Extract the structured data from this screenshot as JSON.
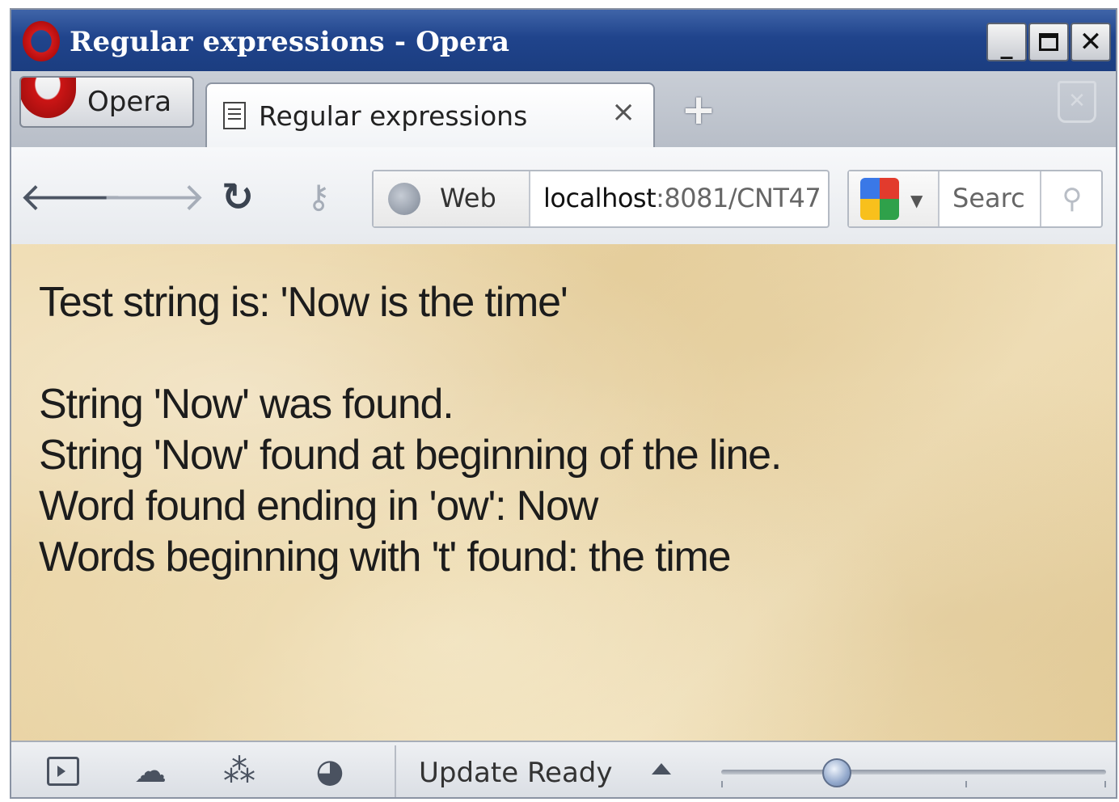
{
  "window": {
    "title": "Regular expressions - Opera"
  },
  "tabbar": {
    "opera_menu_label": "Opera",
    "tabs": [
      {
        "label": "Regular expressions",
        "active": true
      }
    ],
    "close_glyph": "×",
    "new_tab_glyph": "+",
    "trash_glyph": "✕"
  },
  "toolbar": {
    "address": {
      "scheme_label": "Web",
      "url_host": "localhost",
      "url_rest": ":8081/CNT47"
    },
    "search": {
      "placeholder": "Searc"
    }
  },
  "content": {
    "lines": [
      "Test string is: 'Now is the time'",
      "String 'Now' was found.",
      "String 'Now' found at beginning of the line.",
      "Word found ending in 'ow': Now",
      "Words beginning with 't' found: the time"
    ]
  },
  "statusbar": {
    "update_label": "Update Ready",
    "zoom_level": 0.3
  },
  "colors": {
    "titlebar": "#20448c",
    "page_background": "#efdcb2",
    "text": "#1c1c1c"
  },
  "icons": {
    "back": "arrow-left-icon",
    "forward": "arrow-right-icon",
    "reload": "reload-icon",
    "key": "key-icon",
    "globe": "globe-icon",
    "search_engine": "google-icon",
    "search_go": "magnifier-icon",
    "panel": "panel-toggle-icon",
    "cloud": "opera-link-icon",
    "unite": "opera-unite-icon",
    "turbo": "opera-turbo-icon"
  }
}
